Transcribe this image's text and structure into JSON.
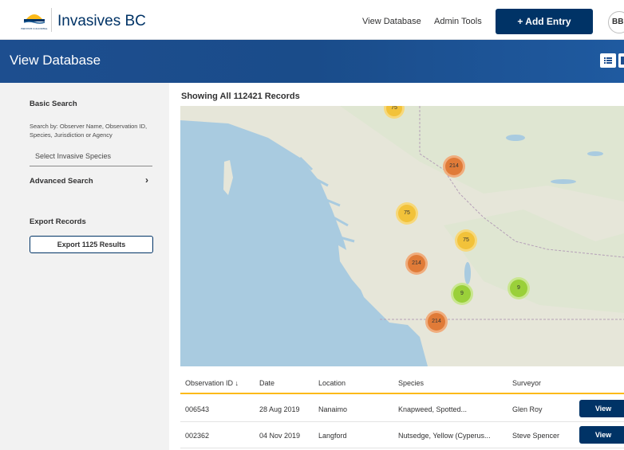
{
  "header": {
    "logo_text": "BRITISH COLUMBIA",
    "brand": "Invasives BC",
    "nav": [
      "View Database",
      "Admin Tools"
    ],
    "add_entry": "+ Add Entry",
    "user_initials": "BB"
  },
  "page": {
    "title": "View Database"
  },
  "sidebar": {
    "basic_search_heading": "Basic Search",
    "search_note": "Search by: Observer Name, Observation ID, Species, Jurisdiction or Agency",
    "species_placeholder": "Select Invasive Species",
    "advanced_search": "Advanced Search",
    "export_heading": "Export Records",
    "export_button": "Export 1125 Results"
  },
  "main": {
    "records_title": "Showing All 112421 Records",
    "clusters": [
      {
        "label": "75",
        "status_color": "#f2c23a"
      },
      {
        "label": "214",
        "status_color": "#e07b38"
      },
      {
        "label": "75",
        "status_color": "#f2c23a"
      },
      {
        "label": "75",
        "status_color": "#f2c23a"
      },
      {
        "label": "214",
        "status_color": "#e07b38"
      },
      {
        "label": "9",
        "status_color": "#9ad03a"
      },
      {
        "label": "9",
        "status_color": "#9ad03a"
      },
      {
        "label": "214",
        "status_color": "#e07b38"
      }
    ]
  },
  "table": {
    "columns": [
      "Observation ID ↓",
      "Date",
      "Location",
      "Species",
      "Surveyor"
    ],
    "rows": [
      {
        "id": "006543",
        "date": "28 Aug 2019",
        "location": "Nanaimo",
        "species": "Knapweed, Spotted...",
        "surveyor": "Glen Roy",
        "action": "View"
      },
      {
        "id": "002362",
        "date": "04 Nov 2019",
        "location": "Langford",
        "species": "Nutsedge, Yellow (Cyperus...",
        "surveyor": "Steve Spencer",
        "action": "View"
      }
    ]
  },
  "colors": {
    "brand_blue": "#003366",
    "accent_gold": "#fcba19",
    "water": "#a9cbe0",
    "land": "#e4e4d8"
  }
}
